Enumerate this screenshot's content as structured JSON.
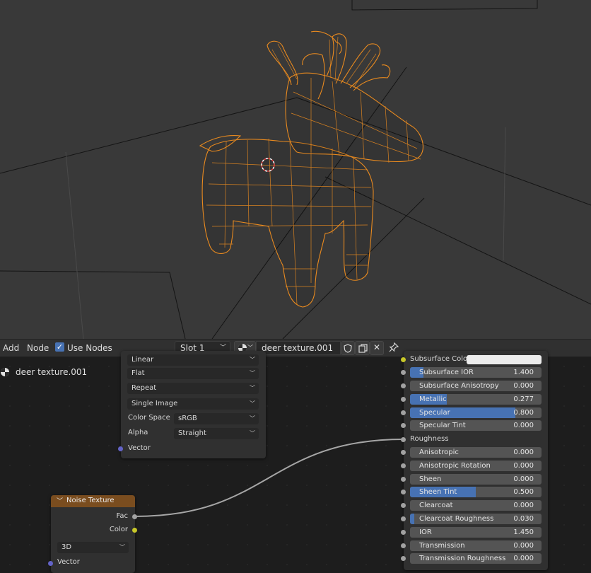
{
  "viewport": {
    "wire_color": "#e98a1f",
    "background": "#393939"
  },
  "header": {
    "add_label": "Add",
    "node_label": "Node",
    "use_nodes_label": "Use Nodes",
    "use_nodes_checked": true,
    "slot_label": "Slot 1",
    "material_name": "deer texture.001",
    "icons": [
      "material-sphere-icon",
      "fake-user-shield-icon",
      "duplicate-icon",
      "close-icon",
      "pin-icon"
    ]
  },
  "editor": {
    "material_label": "deer texture.001",
    "image_node": {
      "interpolation": "Linear",
      "projection": "Flat",
      "extension": "Repeat",
      "source": "Single Image",
      "color_space_label": "Color Space",
      "color_space": "sRGB",
      "alpha_label": "Alpha",
      "alpha": "Straight",
      "vector_label": "Vector"
    },
    "noise_node": {
      "title": "Noise Texture",
      "fac_label": "Fac",
      "color_label": "Color",
      "dimensions": "3D",
      "vector_label": "Vector"
    },
    "bsdf_node": {
      "subsurface_color_label": "Subsurface Color",
      "roughness_label": "Roughness",
      "accent_color": "#4772b3",
      "sliders": [
        {
          "name": "Subsurface IOR",
          "value": "1.400",
          "fill": 0.1
        },
        {
          "name": "Subsurface Anisotropy",
          "value": "0.000",
          "fill": 0
        },
        {
          "name": "Metallic",
          "value": "0.277",
          "fill": 0.277
        },
        {
          "name": "Specular",
          "value": "0.800",
          "fill": 0.8
        },
        {
          "name": "Specular Tint",
          "value": "0.000",
          "fill": 0
        },
        {
          "name": "Anisotropic",
          "value": "0.000",
          "fill": 0
        },
        {
          "name": "Anisotropic Rotation",
          "value": "0.000",
          "fill": 0
        },
        {
          "name": "Sheen",
          "value": "0.000",
          "fill": 0
        },
        {
          "name": "Sheen Tint",
          "value": "0.500",
          "fill": 0.5
        },
        {
          "name": "Clearcoat",
          "value": "0.000",
          "fill": 0
        },
        {
          "name": "Clearcoat Roughness",
          "value": "0.030",
          "fill": 0.03
        },
        {
          "name": "IOR",
          "value": "1.450",
          "fill": 0
        },
        {
          "name": "Transmission",
          "value": "0.000",
          "fill": 0
        },
        {
          "name": "Transmission Roughness",
          "value": "0.000",
          "fill": 0
        }
      ]
    }
  }
}
